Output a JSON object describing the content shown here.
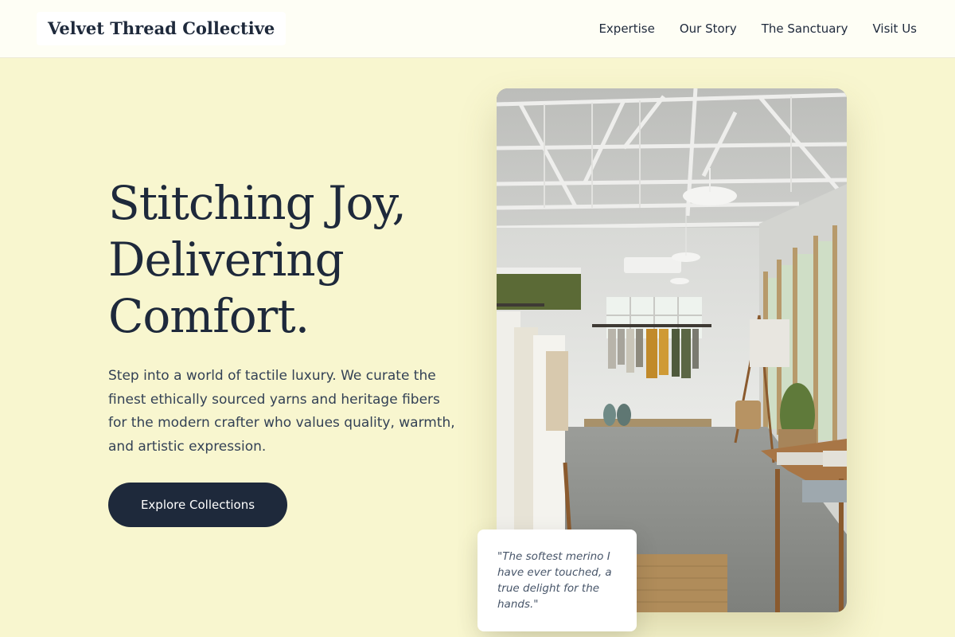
{
  "header": {
    "brand": "Velvet Thread Collective",
    "nav": [
      {
        "label": "Expertise"
      },
      {
        "label": "Our Story"
      },
      {
        "label": "The Sanctuary"
      },
      {
        "label": "Visit Us"
      }
    ]
  },
  "hero": {
    "title_lines": [
      "Stitching Joy,",
      "Delivering",
      "Comfort."
    ],
    "description": "Step into a world of tactile luxury. We curate the finest ethically sourced yarns and heritage fibers for the modern crafter who values quality, warmth, and artistic expression.",
    "cta_label": "Explore Collections"
  },
  "photo": {
    "subject": "boutique-interior-photo"
  },
  "testimonial": {
    "quote": "\"The softest merino I have ever touched, a true delight for the hands.\""
  },
  "colors": {
    "page_background": "#f8f6cf",
    "header_background": "#fefef5",
    "text_dark": "#1e293b",
    "button_background": "#1e293b",
    "button_text": "#ffffff"
  }
}
